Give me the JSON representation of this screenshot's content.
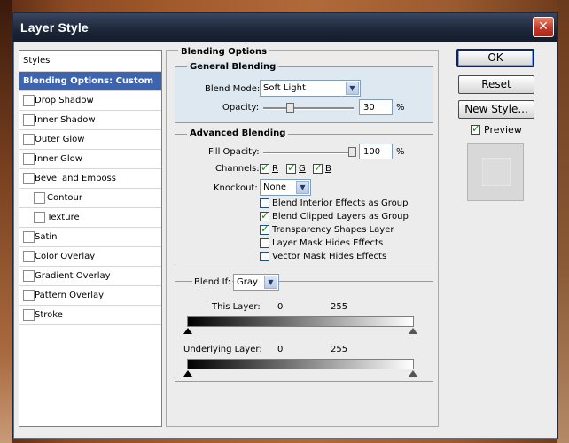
{
  "window": {
    "title": "Layer Style",
    "close_label": "✕"
  },
  "styles_list": {
    "header": "Styles",
    "items": [
      {
        "label": "Blending Options: Custom",
        "selected": true,
        "has_checkbox": false,
        "indent": false
      },
      {
        "label": "Drop Shadow",
        "selected": false,
        "has_checkbox": true,
        "indent": false
      },
      {
        "label": "Inner Shadow",
        "selected": false,
        "has_checkbox": true,
        "indent": false
      },
      {
        "label": "Outer Glow",
        "selected": false,
        "has_checkbox": true,
        "indent": false
      },
      {
        "label": "Inner Glow",
        "selected": false,
        "has_checkbox": true,
        "indent": false
      },
      {
        "label": "Bevel and Emboss",
        "selected": false,
        "has_checkbox": true,
        "indent": false
      },
      {
        "label": "Contour",
        "selected": false,
        "has_checkbox": true,
        "indent": true
      },
      {
        "label": "Texture",
        "selected": false,
        "has_checkbox": true,
        "indent": true
      },
      {
        "label": "Satin",
        "selected": false,
        "has_checkbox": true,
        "indent": false
      },
      {
        "label": "Color Overlay",
        "selected": false,
        "has_checkbox": true,
        "indent": false
      },
      {
        "label": "Gradient Overlay",
        "selected": false,
        "has_checkbox": true,
        "indent": false
      },
      {
        "label": "Pattern Overlay",
        "selected": false,
        "has_checkbox": true,
        "indent": false
      },
      {
        "label": "Stroke",
        "selected": false,
        "has_checkbox": true,
        "indent": false
      }
    ]
  },
  "blending_options": {
    "title": "Blending Options",
    "general": {
      "title": "General Blending",
      "blend_mode_label": "Blend Mode:",
      "blend_mode_value": "Soft Light",
      "opacity_label": "Opacity:",
      "opacity_value": "30",
      "opacity_unit": "%"
    },
    "advanced": {
      "title": "Advanced Blending",
      "fill_opacity_label": "Fill Opacity:",
      "fill_opacity_value": "100",
      "fill_opacity_unit": "%",
      "channels_label": "Channels:",
      "channels": [
        {
          "label": "R",
          "checked": true
        },
        {
          "label": "G",
          "checked": true
        },
        {
          "label": "B",
          "checked": true
        }
      ],
      "knockout_label": "Knockout:",
      "knockout_value": "None",
      "options": [
        {
          "label": "Blend Interior Effects as Group",
          "checked": false
        },
        {
          "label": "Blend Clipped Layers as Group",
          "checked": true
        },
        {
          "label": "Transparency Shapes Layer",
          "checked": true
        },
        {
          "label": "Layer Mask Hides Effects",
          "checked": false
        },
        {
          "label": "Vector Mask Hides Effects",
          "checked": false
        }
      ]
    },
    "blend_if": {
      "label": "Blend If:",
      "value": "Gray",
      "this_layer_label": "This Layer:",
      "this_layer_min": "0",
      "this_layer_max": "255",
      "underlying_label": "Underlying Layer:",
      "underlying_min": "0",
      "underlying_max": "255"
    }
  },
  "buttons": {
    "ok": "OK",
    "reset": "Reset",
    "new_style": "New Style..."
  },
  "preview": {
    "label": "Preview",
    "checked": true
  }
}
